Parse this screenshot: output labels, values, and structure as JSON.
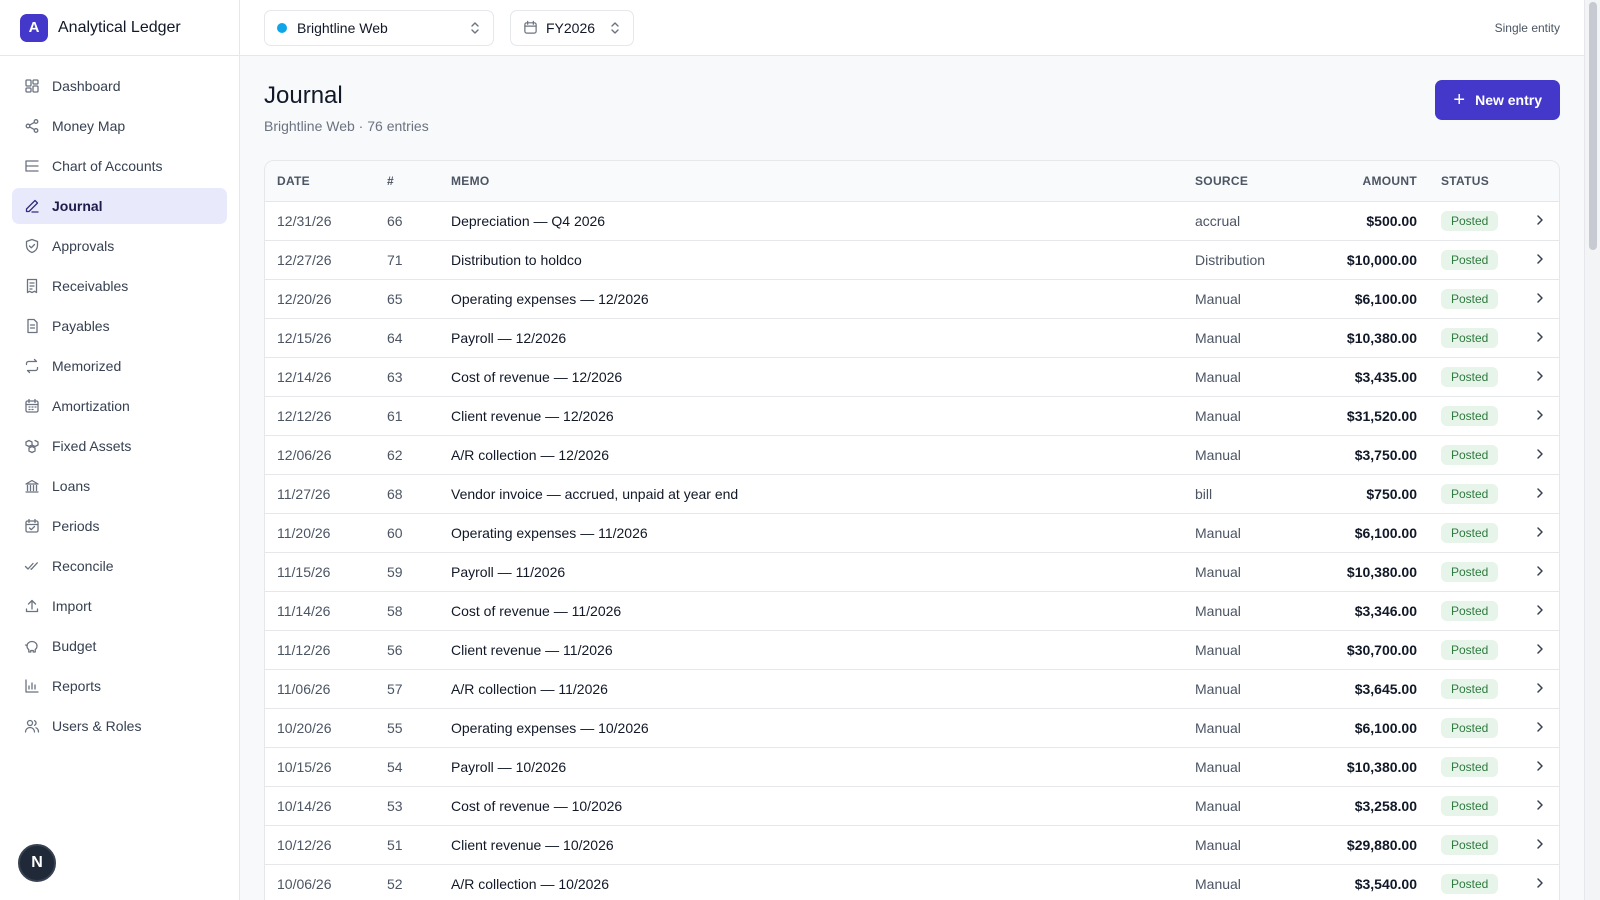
{
  "app": {
    "logo_letter": "A",
    "name": "Analytical Ledger"
  },
  "sidebar": {
    "items": [
      {
        "label": "Dashboard",
        "icon": "dashboard-icon"
      },
      {
        "label": "Money Map",
        "icon": "share-nodes-icon"
      },
      {
        "label": "Chart of Accounts",
        "icon": "list-tree-icon"
      },
      {
        "label": "Journal",
        "icon": "pen-icon",
        "active": true
      },
      {
        "label": "Approvals",
        "icon": "shield-check-icon"
      },
      {
        "label": "Receivables",
        "icon": "receipt-icon"
      },
      {
        "label": "Payables",
        "icon": "document-icon"
      },
      {
        "label": "Memorized",
        "icon": "repeat-icon"
      },
      {
        "label": "Amortization",
        "icon": "calendar-grid-icon"
      },
      {
        "label": "Fixed Assets",
        "icon": "boxes-icon"
      },
      {
        "label": "Loans",
        "icon": "bank-icon"
      },
      {
        "label": "Periods",
        "icon": "calendar-check-icon"
      },
      {
        "label": "Reconcile",
        "icon": "double-check-icon"
      },
      {
        "label": "Import",
        "icon": "upload-icon"
      },
      {
        "label": "Budget",
        "icon": "piggy-bank-icon"
      },
      {
        "label": "Reports",
        "icon": "bar-chart-icon"
      },
      {
        "label": "Users & Roles",
        "icon": "users-icon"
      }
    ],
    "bubble_letter": "N"
  },
  "topbar": {
    "entity": "Brightline Web",
    "entity_color": "#0ea5e9",
    "fiscal_year": "FY2026",
    "mode": "Single entity"
  },
  "page": {
    "title": "Journal",
    "subtitle": "Brightline Web · 76 entries",
    "new_button": "New entry"
  },
  "table": {
    "headers": {
      "date": "DATE",
      "num": "#",
      "memo": "MEMO",
      "source": "SOURCE",
      "amount": "AMOUNT",
      "status": "STATUS"
    },
    "rows": [
      {
        "date": "12/31/26",
        "num": "66",
        "memo": "Depreciation — Q4 2026",
        "source": "accrual",
        "amount": "$500.00",
        "status": "Posted"
      },
      {
        "date": "12/27/26",
        "num": "71",
        "memo": "Distribution to holdco",
        "source": "Distribution",
        "amount": "$10,000.00",
        "status": "Posted"
      },
      {
        "date": "12/20/26",
        "num": "65",
        "memo": "Operating expenses — 12/2026",
        "source": "Manual",
        "amount": "$6,100.00",
        "status": "Posted"
      },
      {
        "date": "12/15/26",
        "num": "64",
        "memo": "Payroll — 12/2026",
        "source": "Manual",
        "amount": "$10,380.00",
        "status": "Posted"
      },
      {
        "date": "12/14/26",
        "num": "63",
        "memo": "Cost of revenue — 12/2026",
        "source": "Manual",
        "amount": "$3,435.00",
        "status": "Posted"
      },
      {
        "date": "12/12/26",
        "num": "61",
        "memo": "Client revenue — 12/2026",
        "source": "Manual",
        "amount": "$31,520.00",
        "status": "Posted"
      },
      {
        "date": "12/06/26",
        "num": "62",
        "memo": "A/R collection — 12/2026",
        "source": "Manual",
        "amount": "$3,750.00",
        "status": "Posted"
      },
      {
        "date": "11/27/26",
        "num": "68",
        "memo": "Vendor invoice — accrued, unpaid at year end",
        "source": "bill",
        "amount": "$750.00",
        "status": "Posted"
      },
      {
        "date": "11/20/26",
        "num": "60",
        "memo": "Operating expenses — 11/2026",
        "source": "Manual",
        "amount": "$6,100.00",
        "status": "Posted"
      },
      {
        "date": "11/15/26",
        "num": "59",
        "memo": "Payroll — 11/2026",
        "source": "Manual",
        "amount": "$10,380.00",
        "status": "Posted"
      },
      {
        "date": "11/14/26",
        "num": "58",
        "memo": "Cost of revenue — 11/2026",
        "source": "Manual",
        "amount": "$3,346.00",
        "status": "Posted"
      },
      {
        "date": "11/12/26",
        "num": "56",
        "memo": "Client revenue — 11/2026",
        "source": "Manual",
        "amount": "$30,700.00",
        "status": "Posted"
      },
      {
        "date": "11/06/26",
        "num": "57",
        "memo": "A/R collection — 11/2026",
        "source": "Manual",
        "amount": "$3,645.00",
        "status": "Posted"
      },
      {
        "date": "10/20/26",
        "num": "55",
        "memo": "Operating expenses — 10/2026",
        "source": "Manual",
        "amount": "$6,100.00",
        "status": "Posted"
      },
      {
        "date": "10/15/26",
        "num": "54",
        "memo": "Payroll — 10/2026",
        "source": "Manual",
        "amount": "$10,380.00",
        "status": "Posted"
      },
      {
        "date": "10/14/26",
        "num": "53",
        "memo": "Cost of revenue — 10/2026",
        "source": "Manual",
        "amount": "$3,258.00",
        "status": "Posted"
      },
      {
        "date": "10/12/26",
        "num": "51",
        "memo": "Client revenue — 10/2026",
        "source": "Manual",
        "amount": "$29,880.00",
        "status": "Posted"
      },
      {
        "date": "10/06/26",
        "num": "52",
        "memo": "A/R collection — 10/2026",
        "source": "Manual",
        "amount": "$3,540.00",
        "status": "Posted"
      }
    ]
  }
}
